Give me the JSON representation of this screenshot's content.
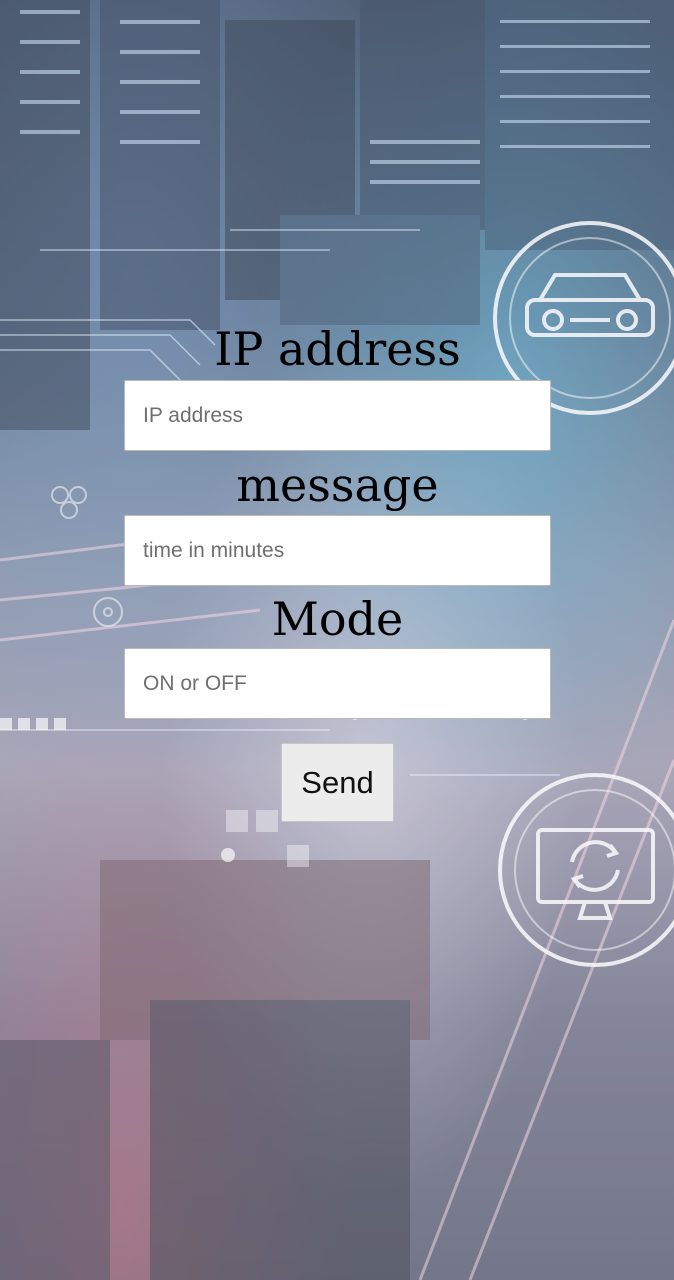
{
  "form": {
    "ip_label": "IP address",
    "ip_placeholder": "IP address",
    "message_label": "message",
    "message_placeholder": "time in minutes",
    "mode_label": "Mode",
    "mode_placeholder": "ON or OFF",
    "send_label": "Send"
  },
  "background": {
    "description_icons": [
      "car-icon",
      "monitor-refresh-icon"
    ]
  }
}
